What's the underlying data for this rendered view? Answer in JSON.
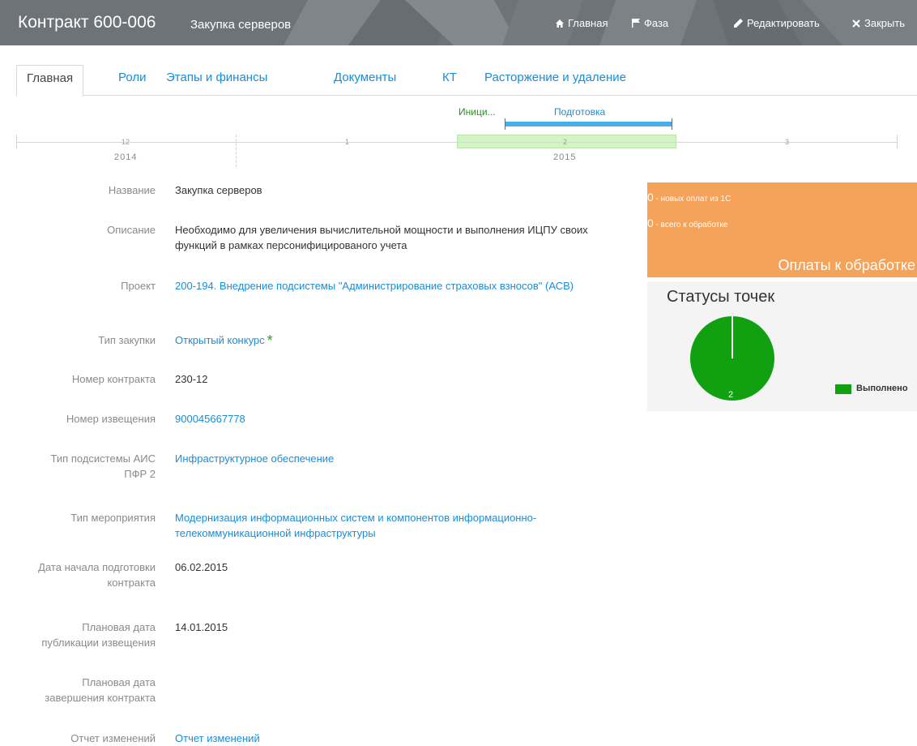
{
  "header": {
    "title": "Контракт 600-006",
    "subtitle": "Закупка серверов",
    "nav": {
      "home": "Главная",
      "phase": "Фаза",
      "edit": "Редактировать",
      "close": "Закрыть"
    },
    "bg_color": "#6e7378"
  },
  "tabs": [
    {
      "label": "Главная",
      "active": true
    },
    {
      "label": "Роли"
    },
    {
      "label": "Этапы и финансы"
    },
    {
      "label": "Документы"
    },
    {
      "label": "КТ"
    },
    {
      "label": "Расторжение и удаление"
    }
  ],
  "timeline": {
    "phases": [
      {
        "label": "Иници...",
        "color": "#2a8f2a"
      },
      {
        "label": "Подготовка",
        "color": "#1b8dd6"
      }
    ],
    "months": [
      "12",
      "1",
      "2",
      "3"
    ],
    "years": [
      "2014",
      "2015"
    ],
    "highlight_color": "#d4f4c7"
  },
  "fields": [
    {
      "label": "Название",
      "value": "Закупка серверов",
      "link": false
    },
    {
      "label": "Описание",
      "value": "Необходимо для увеличения вычислительной мощности и выполнения ИЦПУ своих функций в рамках персонифицированого учета",
      "link": false
    },
    {
      "label": "Проект",
      "value": "200-194. Внедрение подсистемы \"Администрирование страховых взносов\" (АСВ)",
      "link": true
    },
    {
      "label": "Тип закупки",
      "value": "Открытый конкурс",
      "link": true,
      "star": "*"
    },
    {
      "label": "Номер контракта",
      "value": "230-12",
      "link": false
    },
    {
      "label": "Номер извещения",
      "value": "900045667778",
      "link": true
    },
    {
      "label": "Тип подсистемы АИС ПФР 2",
      "value": "Инфраструктурное обеспечение",
      "link": true
    },
    {
      "label": "Тип мероприятия",
      "value": "Модернизация информационных систем и компонентов информационно-телекоммуникационной инфраструктуры",
      "link": true
    },
    {
      "label": "Дата начала подготовки контракта",
      "value": "06.02.2015",
      "link": false
    },
    {
      "label": "Плановая дата публикации извещения",
      "value": "14.01.2015",
      "link": false
    },
    {
      "label": "Плановая дата завершения контракта",
      "value": "",
      "link": false
    },
    {
      "label": "Отчет изменений",
      "value": "Отчет изменений",
      "link": true
    }
  ],
  "payments": {
    "new_count": "0",
    "new_label": "- новых оплат из 1С",
    "total_count": "0",
    "total_label": "- всего к обработке",
    "title": "Оплаты к обработке",
    "color": "#f5a25a"
  },
  "statuses": {
    "title": "Статусы точек",
    "chart_data": {
      "type": "pie",
      "categories": [
        "Выполнено"
      ],
      "values": [
        2
      ],
      "colors": [
        "#10a010"
      ]
    }
  }
}
